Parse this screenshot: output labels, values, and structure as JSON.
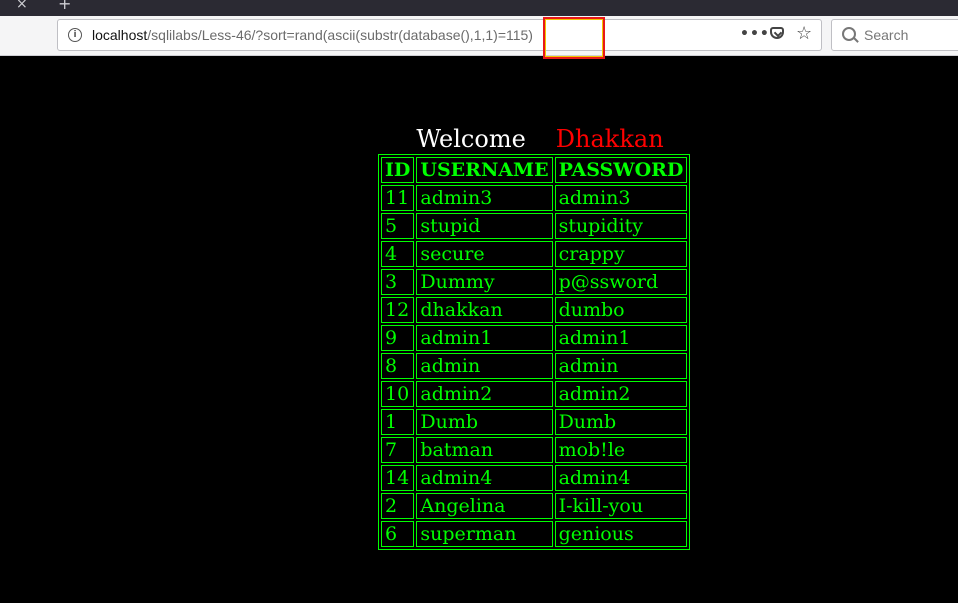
{
  "browser": {
    "url_host": "localhost",
    "url_path_before": "/sqlilabs/Less-46/?sort=rand(ascii(substr(database(),1,1)",
    "url_path_highlight": "=115)",
    "search_placeholder": "Search",
    "more_glyph": "•••",
    "star_glyph": "☆"
  },
  "page": {
    "welcome_word": "Welcome",
    "welcome_name": "Dhakkan",
    "colors": {
      "background": "#000000",
      "table": "#00ff00",
      "name": "#ff0000",
      "highlight_box": "#e81818"
    }
  },
  "table": {
    "headers": [
      "ID",
      "USERNAME",
      "PASSWORD"
    ],
    "rows": [
      [
        "11",
        "admin3",
        "admin3"
      ],
      [
        "5",
        "stupid",
        "stupidity"
      ],
      [
        "4",
        "secure",
        "crappy"
      ],
      [
        "3",
        "Dummy",
        "p@ssword"
      ],
      [
        "12",
        "dhakkan",
        "dumbo"
      ],
      [
        "9",
        "admin1",
        "admin1"
      ],
      [
        "8",
        "admin",
        "admin"
      ],
      [
        "10",
        "admin2",
        "admin2"
      ],
      [
        "1",
        "Dumb",
        "Dumb"
      ],
      [
        "7",
        "batman",
        "mob!le"
      ],
      [
        "14",
        "admin4",
        "admin4"
      ],
      [
        "2",
        "Angelina",
        "I-kill-you"
      ],
      [
        "6",
        "superman",
        "genious"
      ]
    ]
  }
}
